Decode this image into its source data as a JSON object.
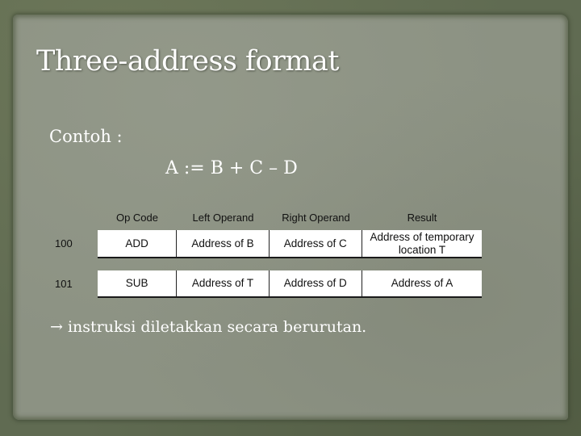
{
  "slide": {
    "title": "Three-address format",
    "example_label": "Contoh :",
    "formula": "A := B + C – D",
    "note_arrow": "→",
    "note": "instruksi diletakkan secara berurutan."
  },
  "table": {
    "headers": [
      "Op Code",
      "Left Operand",
      "Right Operand",
      "Result"
    ],
    "rows": [
      {
        "address": "100",
        "cells": [
          "ADD",
          "Address of  B",
          "Address of  C",
          "Address of temporary location T"
        ]
      },
      {
        "address": "101",
        "cells": [
          "SUB",
          "Address of  T",
          "Address of  D",
          "Address of  A"
        ]
      }
    ]
  },
  "colors": {
    "background": "#606b52",
    "paper": "#8c9283",
    "text": "#ffffff",
    "table_fill": "#ffffff"
  }
}
